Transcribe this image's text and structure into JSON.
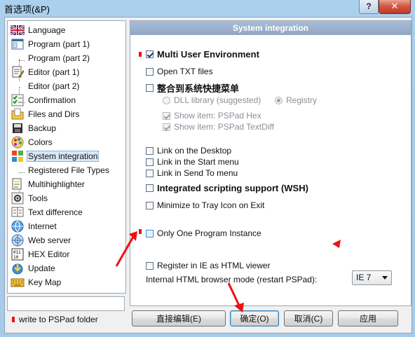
{
  "window": {
    "title": "首选项(&P)",
    "close_label": "✕",
    "help_label": "?"
  },
  "tree": {
    "items": [
      {
        "label": "Language",
        "icon": "flag-uk-icon"
      },
      {
        "label": "Program  (part 1)",
        "icon": "program-icon"
      },
      {
        "label": "Program  (part 2)",
        "icon": ""
      },
      {
        "label": "Editor  (part 1)",
        "icon": "editor-icon"
      },
      {
        "label": "Editor  (part 2)",
        "icon": ""
      },
      {
        "label": "Confirmation",
        "icon": "checklist-icon"
      },
      {
        "label": "Files and Dirs",
        "icon": "files-icon"
      },
      {
        "label": "Backup",
        "icon": "backup-icon"
      },
      {
        "label": "Colors",
        "icon": "colors-icon"
      },
      {
        "label": "System integration",
        "icon": "windows-icon"
      },
      {
        "label": "Registered File Types",
        "icon": ""
      },
      {
        "label": "Multihighlighter",
        "icon": "highlighter-icon"
      },
      {
        "label": "Tools",
        "icon": "tools-icon"
      },
      {
        "label": "Text difference",
        "icon": "diff-icon"
      },
      {
        "label": "Internet",
        "icon": "globe-icon"
      },
      {
        "label": "Web server",
        "icon": "server-icon"
      },
      {
        "label": "HEX Editor",
        "icon": "hex-icon"
      },
      {
        "label": "Update",
        "icon": "update-icon"
      },
      {
        "label": "Key Map",
        "icon": "keyboard-icon"
      }
    ],
    "selected": "System integration",
    "search_value": "",
    "folder_note": "write to PSPad folder"
  },
  "panel": {
    "header": "System integration",
    "options": {
      "multi_user": "Multi User Environment",
      "open_txt": "Open TXT files",
      "context_menu": "整合到系统快捷菜单",
      "dll_library": "DLL library (suggested)",
      "registry": "Registry",
      "show_hex": "Show item: PSPad Hex",
      "show_textdiff": "Show item: PSPad TextDiff",
      "link_desktop": "Link on the Desktop",
      "link_start": "Link in the Start menu",
      "link_sendto": "Link in Send To menu",
      "wsh": "Integrated scripting support (WSH)",
      "minimize_tray": "Minimize to Tray Icon on Exit",
      "one_instance": "Only One Program Instance",
      "register_ie": "Register in IE as HTML viewer"
    },
    "browser_mode_label": "Internal HTML browser mode (restart PSPad):",
    "browser_mode_value": "IE 7"
  },
  "buttons": {
    "edit_direct": "直接编辑(E)",
    "ok": "确定(O)",
    "cancel": "取消(C)",
    "apply": "应用"
  },
  "colors": {
    "accent_red": "#e11",
    "title_bar": "#a6cbe8",
    "panel_header": "#8fa6c4"
  }
}
